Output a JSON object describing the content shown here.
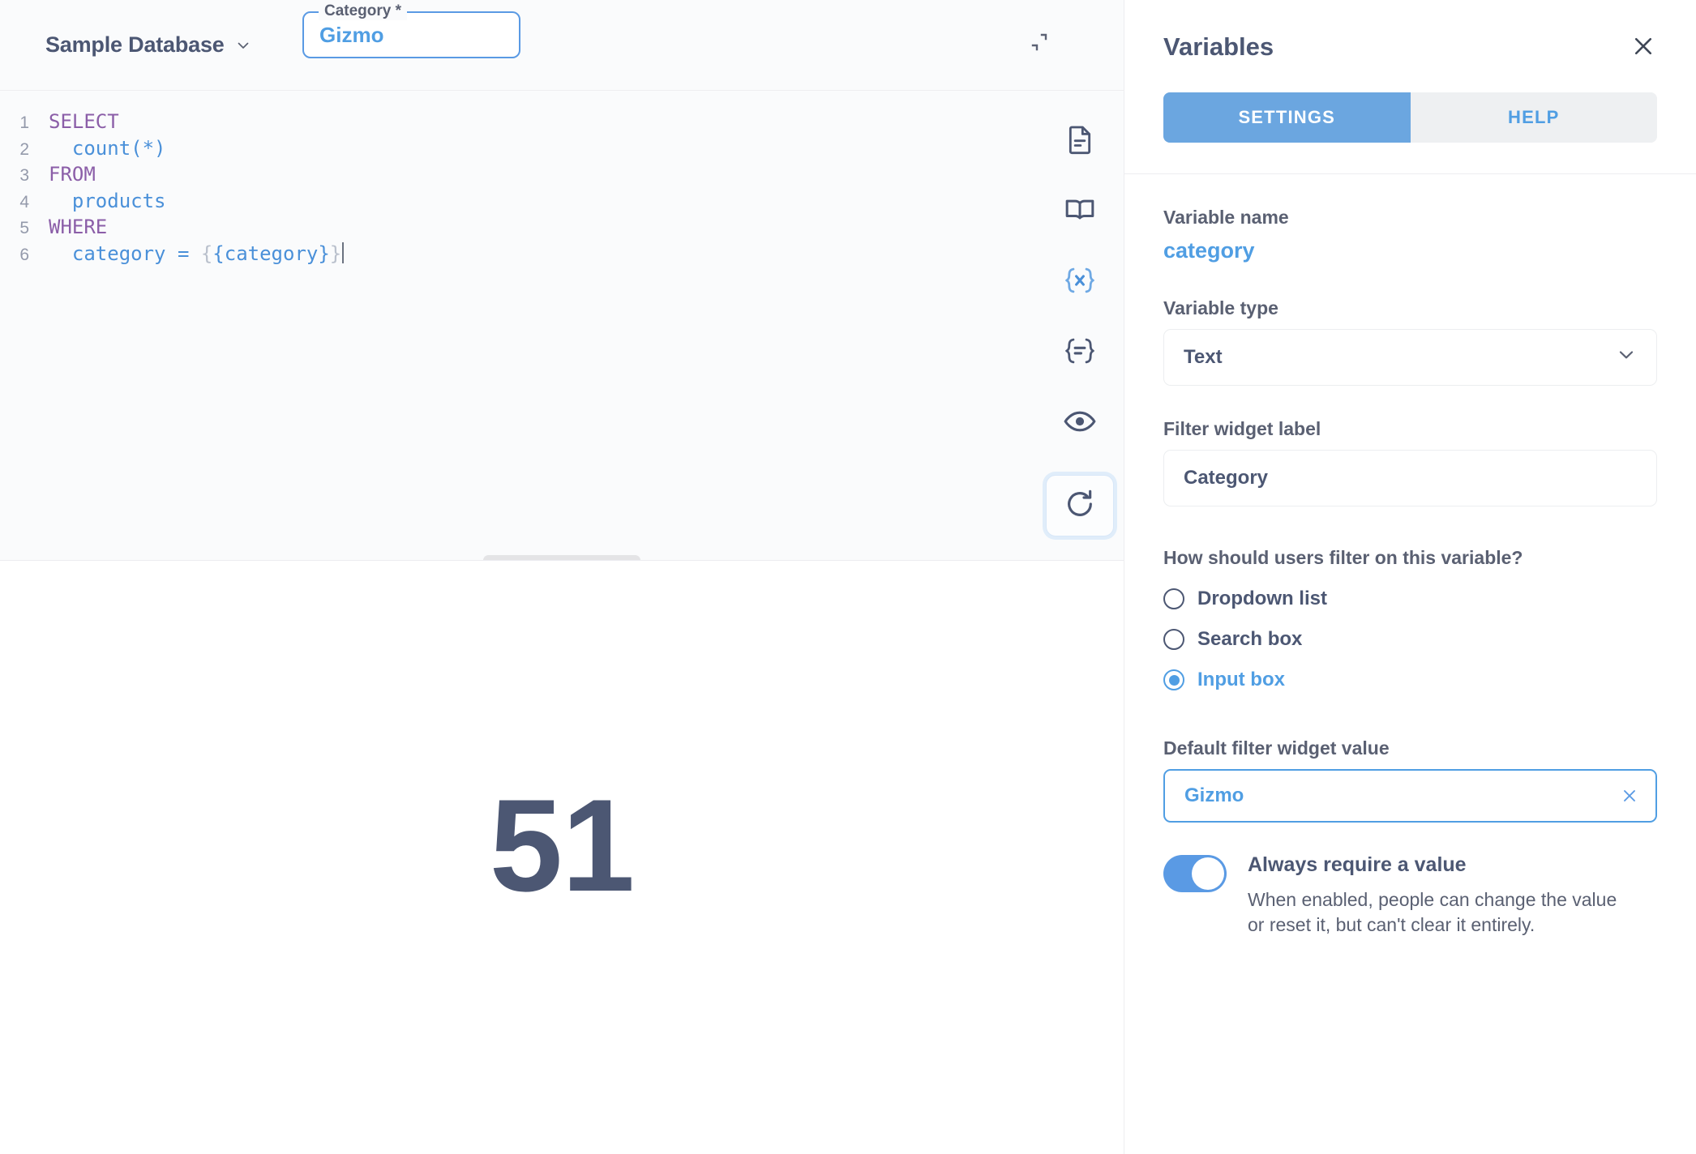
{
  "editor": {
    "database": "Sample Database",
    "database_chevron_icon": "chevron-down-icon",
    "collapse_icon": "contract-icon",
    "filter_widget": {
      "label": "Category",
      "required_marker": "*",
      "value": "Gizmo"
    },
    "code": {
      "lines": [
        {
          "n": "1",
          "segments": [
            {
              "t": "SELECT",
              "c": "kw"
            }
          ]
        },
        {
          "n": "2",
          "segments": [
            {
              "t": "  ",
              "c": "pl"
            },
            {
              "t": "count",
              "c": "fn"
            },
            {
              "t": "(*)",
              "c": "pl"
            }
          ]
        },
        {
          "n": "3",
          "segments": [
            {
              "t": "FROM",
              "c": "kw"
            }
          ]
        },
        {
          "n": "4",
          "segments": [
            {
              "t": "  products",
              "c": "pl"
            }
          ]
        },
        {
          "n": "5",
          "segments": [
            {
              "t": "WHERE",
              "c": "kw"
            }
          ]
        },
        {
          "n": "6",
          "segments": [
            {
              "t": "  category = ",
              "c": "pl"
            },
            {
              "t": "{",
              "c": "brk"
            },
            {
              "t": "{category}",
              "c": "fn"
            },
            {
              "t": "}",
              "c": "brk"
            }
          ]
        }
      ],
      "raw": "SELECT\n  count(*)\nFROM\n  products\nWHERE\n  category = {{category}}"
    },
    "rail": [
      {
        "icon": "document-icon",
        "label": "Data reference"
      },
      {
        "icon": "book-icon",
        "label": "Native query snippets"
      },
      {
        "icon": "variables-icon",
        "label": "Variables",
        "active": true
      },
      {
        "icon": "format-icon",
        "label": "Format query"
      },
      {
        "icon": "eye-icon",
        "label": "Preview query"
      },
      {
        "icon": "refresh-icon",
        "label": "Run query",
        "focused": true
      }
    ],
    "drag_handle": "resize-handle"
  },
  "results": {
    "scalar_value": "51"
  },
  "panel": {
    "title": "Variables",
    "close_icon": "close-icon",
    "tabs": [
      {
        "label": "SETTINGS",
        "active": true
      },
      {
        "label": "HELP",
        "active": false
      }
    ],
    "variable_name_label": "Variable name",
    "variable_name": "category",
    "variable_type_label": "Variable type",
    "variable_type": "Text",
    "variable_type_chevron": "chevron-down-icon",
    "filter_widget_label_label": "Filter widget label",
    "filter_widget_label_value": "Category",
    "filter_question": "How should users filter on this variable?",
    "filter_options": [
      {
        "label": "Dropdown list",
        "selected": false
      },
      {
        "label": "Search box",
        "selected": false
      },
      {
        "label": "Input box",
        "selected": true
      }
    ],
    "default_value_label": "Default filter widget value",
    "default_value": "Gizmo",
    "default_clear_icon": "close-icon",
    "require_toggle": {
      "on": true,
      "title": "Always require a value",
      "description": "When enabled, people can change the value or reset it, but can't clear it entirely."
    }
  },
  "colors": {
    "brand_blue": "#509ee3",
    "tab_active": "#6ba6e0",
    "text_dark": "#4c5773",
    "text_medium": "#5a6072",
    "keyword_purple": "#8b5ea8",
    "border_light": "#ededf0",
    "editor_bg": "#fafbfc"
  }
}
